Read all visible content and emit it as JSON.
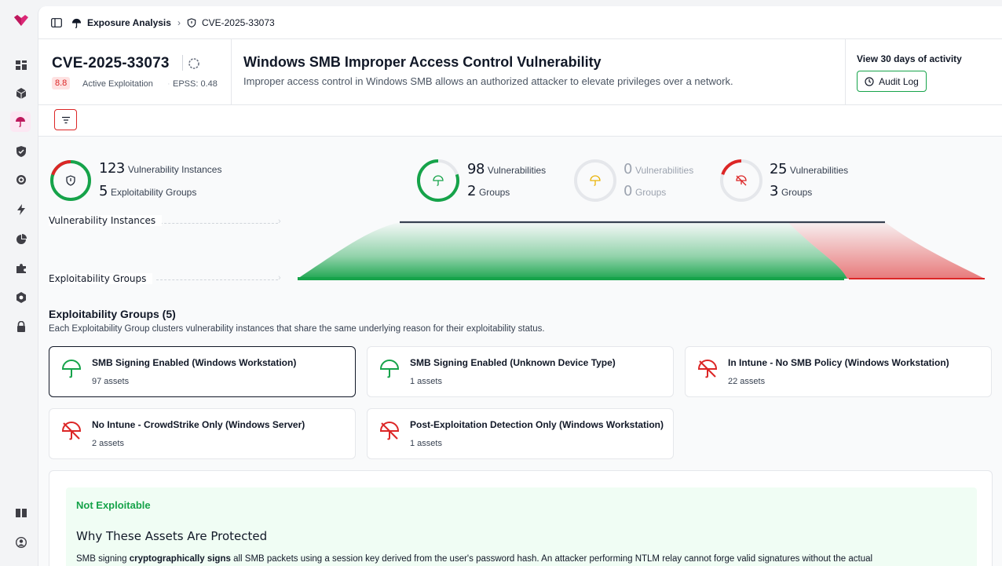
{
  "breadcrumb": {
    "section": "Exposure Analysis",
    "current": "CVE-2025-33073"
  },
  "cve": {
    "id": "CVE-2025-33073",
    "score": "8.8",
    "status": "Active Exploitation",
    "separator": "·",
    "epss": "EPSS: 0.48"
  },
  "vulnerability": {
    "title": "Windows SMB Improper Access Control Vulnerability",
    "description": "Improper access control in Windows SMB allows an authorized attacker to elevate privileges over a network."
  },
  "activity": {
    "title": "View 30 days of activity",
    "audit_label": "Audit Log"
  },
  "summary": {
    "instances_count": "123",
    "instances_label": "Vulnerability Instances",
    "groups_count": "5",
    "groups_label": "Exploitability Groups",
    "risk_fraction": 0.2
  },
  "buckets": [
    {
      "vulns": "98",
      "vulns_label": "Vulnerabilities",
      "groups": "2",
      "groups_label": "Groups",
      "color": "#16a34a",
      "fraction": 0.8
    },
    {
      "vulns": "0",
      "vulns_label": "Vulnerabilities",
      "groups": "0",
      "groups_label": "Groups",
      "color": "#eab308",
      "fraction": 0
    },
    {
      "vulns": "25",
      "vulns_label": "Vulnerabilities",
      "groups": "3",
      "groups_label": "Groups",
      "color": "#dc2626",
      "fraction": 0.2
    }
  ],
  "flow_labels": {
    "instances": "Vulnerability Instances",
    "groups": "Exploitability Groups"
  },
  "groups_section": {
    "title": "Exploitability Groups (5)",
    "description": "Each Exploitability Group clusters vulnerability instances that share the same underlying reason for their exploitability status."
  },
  "groups": [
    {
      "title": "SMB Signing Enabled (Windows Workstation)",
      "assets": "97 assets",
      "icon": "umbrella-green"
    },
    {
      "title": "SMB Signing Enabled (Unknown Device Type)",
      "assets": "1 assets",
      "icon": "umbrella-green"
    },
    {
      "title": "In Intune - No SMB Policy (Windows Workstation)",
      "assets": "22 assets",
      "icon": "umbrella-off-red"
    },
    {
      "title": "No Intune - CrowdStrike Only (Windows Server)",
      "assets": "2 assets",
      "icon": "umbrella-off-red"
    },
    {
      "title": "Post-Exploitation Detection Only (Windows Workstation)",
      "assets": "1 assets",
      "icon": "umbrella-off-red"
    }
  ],
  "detail": {
    "status": "Not Exploitable",
    "heading": "Why These Assets Are Protected",
    "text_1": "SMB signing ",
    "text_bold": "cryptographically signs",
    "text_2": " all SMB packets using a session key derived from the user's password hash. An attacker performing NTLM relay cannot forge valid signatures without the actual"
  },
  "colors": {
    "green": "#16a34a",
    "red": "#dc2626",
    "yellow": "#eab308",
    "brand": "#be185d"
  }
}
